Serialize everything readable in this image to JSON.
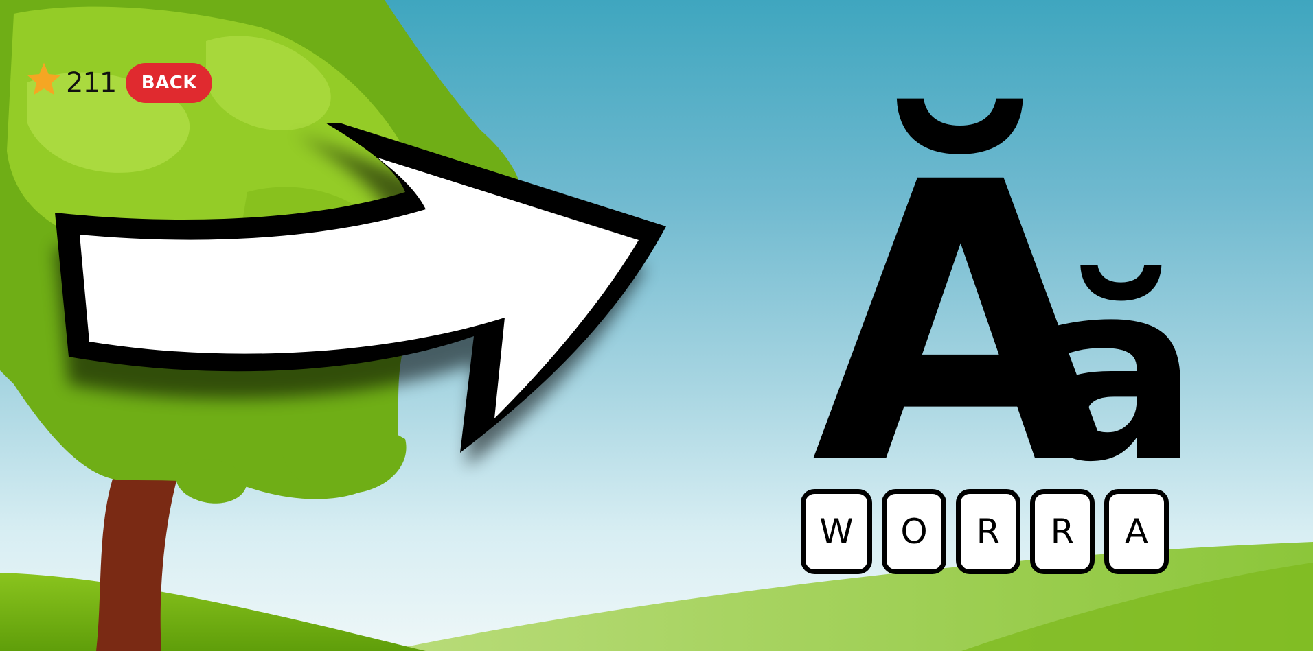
{
  "hud": {
    "score": "211",
    "back_label": "BACK",
    "star_icon": "star-icon",
    "colors": {
      "star": "#f5a623",
      "back_button": "#e02a2f"
    }
  },
  "letter_display": {
    "uppercase": "Ă",
    "lowercase": "ă"
  },
  "answer_tiles": [
    "W",
    "O",
    "R",
    "R",
    "A"
  ],
  "decor": {
    "arrow_icon": "right-arrow-icon",
    "tree": "tree",
    "sky_color": "#3fa6bf",
    "grass_color": "#7dbb16"
  }
}
